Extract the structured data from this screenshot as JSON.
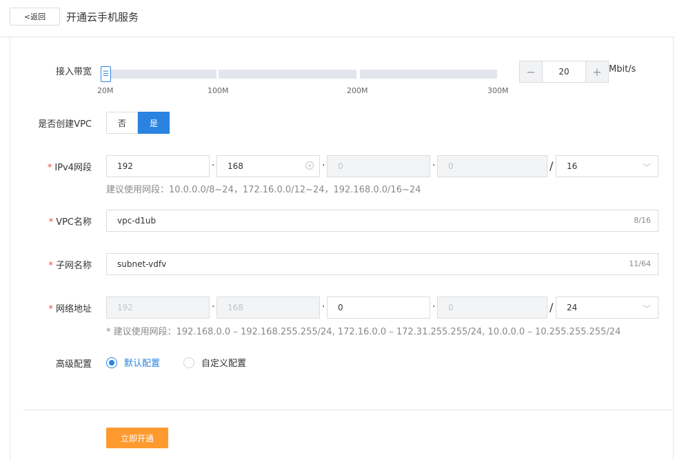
{
  "header": {
    "back_label": "<返回",
    "title": "开通云手机服务"
  },
  "bandwidth": {
    "label": "接入带宽",
    "ticks": [
      "20M",
      "100M",
      "200M",
      "300M"
    ],
    "value": "20",
    "unit": "Mbit/s",
    "minus": "−",
    "plus": "+",
    "thumb_glyph": "☰"
  },
  "vpc_toggle": {
    "label": "是否创建VPC",
    "no": "否",
    "yes": "是",
    "selected": "是"
  },
  "ipv4": {
    "label": "IPv4网段",
    "octets": [
      "192",
      "168",
      "0",
      "0"
    ],
    "mask": "16",
    "hint": "建议使用网段：10.0.0.0/8~24，172.16.0.0/12~24，192.168.0.0/16~24"
  },
  "vpc_name": {
    "label": "VPC名称",
    "value": "vpc-d1ub",
    "count": "8/16"
  },
  "subnet_name": {
    "label": "子网名称",
    "value": "subnet-vdfv",
    "count": "11/64"
  },
  "net_address": {
    "label": "网络地址",
    "octets": [
      "192",
      "168",
      "0",
      "0"
    ],
    "mask": "24",
    "hint": "* 建议使用网段：192.168.0.0 – 192.168.255.255/24, 172.16.0.0 – 172.31.255.255/24, 10.0.0.0 – 10.255.255.255/24"
  },
  "advanced": {
    "label": "高级配置",
    "default_label": "默认配置",
    "custom_label": "自定义配置",
    "selected": "默认配置"
  },
  "separators": {
    "dot": "·",
    "slash": "/",
    "caret": "﹀",
    "clear": "✕",
    "asterisk": "*"
  },
  "submit_label": "立即开通",
  "colors": {
    "accent": "#2a83e0",
    "submit": "#ff9a2e",
    "required": "#e84c3d"
  }
}
